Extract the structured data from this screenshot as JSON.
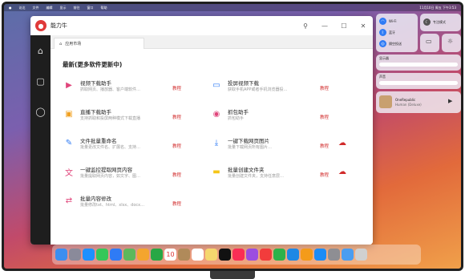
{
  "menubar": {
    "items": [
      "访达",
      "文件",
      "编辑",
      "显示",
      "前往",
      "窗口",
      "帮助"
    ],
    "clock": "11月10日 周五 下午3:53"
  },
  "app": {
    "title": "能力牛",
    "tab_label": "应用市场",
    "section_title": "最新(更多软件更新中)",
    "cards": [
      {
        "name": "视频下载助手",
        "desc": "抓取网页、播放器、客户端软件…",
        "link": "教程",
        "icon": "video-download-icon",
        "icon_char": "▶",
        "color": "#e0457b",
        "col": 0,
        "row": 0,
        "cloud": false
      },
      {
        "name": "投屏视频下载",
        "desc": "获取手机APP或者手机浏览器投…",
        "link": "教程",
        "icon": "cast-icon",
        "icon_char": "▭",
        "color": "#2f7bf5",
        "col": 1,
        "row": 0,
        "cloud": false
      },
      {
        "name": "直播下载助手",
        "desc": "支持抓取和投屏两种模式下载直播",
        "link": "教程",
        "icon": "live-icon",
        "icon_char": "▣",
        "color": "#f0a020",
        "col": 0,
        "row": 1,
        "cloud": false
      },
      {
        "name": "抓包助手",
        "desc": "抓包助手",
        "link": "教程",
        "icon": "capture-icon",
        "icon_char": "◉",
        "color": "#e0457b",
        "col": 1,
        "row": 1,
        "cloud": false
      },
      {
        "name": "文件批量重命名",
        "desc": "批量更改文件名、扩展名、支持…",
        "link": "教程",
        "icon": "rename-icon",
        "icon_char": "✎",
        "color": "#2f7bf5",
        "col": 0,
        "row": 2,
        "cloud": false
      },
      {
        "name": "一键下载网页图片",
        "desc": "批量下载网页所有图片…",
        "link": "教程",
        "icon": "image-download-icon",
        "icon_char": "⤓",
        "color": "#2f7bf5",
        "col": 1,
        "row": 2,
        "cloud": true
      },
      {
        "name": "一键监控提取网页内容",
        "desc": "批量提取网页内容，如文字、图…",
        "link": "教程",
        "icon": "translate-icon",
        "icon_char": "文",
        "color": "#e0457b",
        "col": 0,
        "row": 3,
        "cloud": false
      },
      {
        "name": "批量创建文件夹",
        "desc": "批量创建文件夹，支持任意层…",
        "link": "教程",
        "icon": "folder-icon",
        "icon_char": "▬",
        "color": "#f5c518",
        "col": 1,
        "row": 3,
        "cloud": true
      },
      {
        "name": "批量内容修改",
        "desc": "批量修改txt、html、xlsx、docx…",
        "link": "教程",
        "icon": "edit-content-icon",
        "icon_char": "⇄",
        "color": "#e0457b",
        "col": 0,
        "row": 4,
        "cloud": false
      }
    ]
  },
  "control_center": {
    "wifi_label": "Wi-Fi",
    "bluetooth_label": "蓝牙",
    "airdrop_label": "隔空投送",
    "focus_label": "专注模式",
    "display_label": "显示器",
    "sound_label": "声音",
    "now_playing_title": "OneRepublic",
    "now_playing_artist": "Human (Deluxe)"
  },
  "dock": {
    "apps": [
      {
        "icon": "finder-icon",
        "color": "#3c8ef0"
      },
      {
        "icon": "launchpad-icon",
        "color": "#8a8a9a"
      },
      {
        "icon": "safari-icon",
        "color": "#1e90ff"
      },
      {
        "icon": "messages-icon",
        "color": "#34c759"
      },
      {
        "icon": "mail-icon",
        "color": "#2f7bf5"
      },
      {
        "icon": "maps-icon",
        "color": "#5cb85c"
      },
      {
        "icon": "photos-icon",
        "color": "#f4a52e"
      },
      {
        "icon": "facetime-icon",
        "color": "#28a745"
      },
      {
        "icon": "calendar-icon",
        "color": "#ffffff"
      },
      {
        "icon": "contacts-icon",
        "color": "#b08a5a"
      },
      {
        "icon": "reminders-icon",
        "color": "#ffffff"
      },
      {
        "icon": "notes-icon",
        "color": "#f5d76e"
      },
      {
        "icon": "tv-icon",
        "color": "#111111"
      },
      {
        "icon": "music-icon",
        "color": "#fa2d55"
      },
      {
        "icon": "podcasts-icon",
        "color": "#9b4de0"
      },
      {
        "icon": "news-icon",
        "color": "#f23c3c"
      },
      {
        "icon": "numbers-icon",
        "color": "#2db24a"
      },
      {
        "icon": "keynote-icon",
        "color": "#1e88e5"
      },
      {
        "icon": "pages-icon",
        "color": "#f49b1a"
      },
      {
        "icon": "appstore-icon",
        "color": "#1c8cf5"
      },
      {
        "icon": "settings-icon",
        "color": "#8e8e93"
      },
      {
        "icon": "downloads-icon",
        "color": "#4a9df0"
      },
      {
        "icon": "trash-icon",
        "color": "#d0d0d0"
      }
    ],
    "calendar_day": "10"
  }
}
